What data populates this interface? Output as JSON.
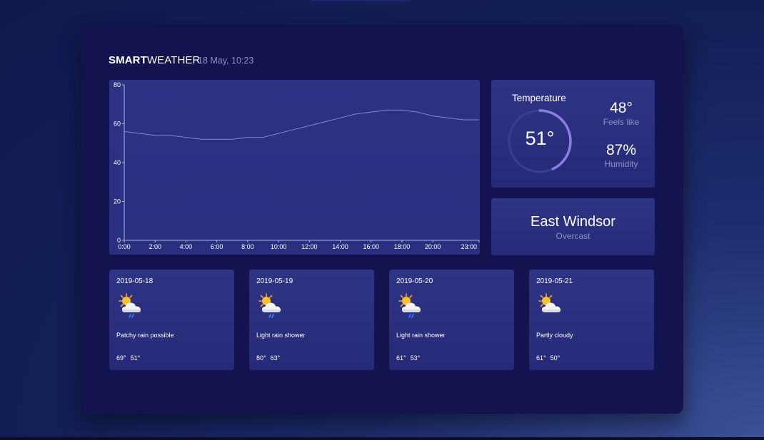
{
  "header": {
    "brand_bold": "SMART",
    "brand_light": "WEATHER",
    "datetime": "18 May, 10:23"
  },
  "chart_data": {
    "type": "line",
    "x": [
      0,
      1,
      2,
      3,
      4,
      5,
      6,
      7,
      8,
      9,
      10,
      11,
      12,
      13,
      14,
      15,
      16,
      17,
      18,
      19,
      20,
      21,
      22,
      23
    ],
    "xticks": [
      "0:00",
      "2:00",
      "4:00",
      "6:00",
      "8:00",
      "10:00",
      "12:00",
      "14:00",
      "16:00",
      "18:00",
      "20:00",
      "23:00"
    ],
    "xtick_hours": [
      0,
      2,
      4,
      6,
      8,
      10,
      12,
      14,
      16,
      18,
      20,
      23
    ],
    "yticks": [
      "0",
      "20",
      "40",
      "60",
      "80"
    ],
    "series": [
      {
        "values": [
          56,
          55,
          54,
          54,
          53,
          52,
          52,
          52,
          53,
          53,
          55,
          57,
          59,
          61,
          63,
          65,
          66,
          67,
          67,
          66,
          64,
          63,
          62,
          62
        ]
      }
    ],
    "xlim": [
      0,
      23
    ],
    "ylim": [
      0,
      80
    ],
    "grid": false,
    "line_color": "#8088d0"
  },
  "current": {
    "title": "Temperature",
    "temp": "51°",
    "gauge_fraction": 0.43,
    "feels_like": "48°",
    "feels_like_label": "Feels like",
    "humidity": "87%",
    "humidity_label": "Humidity"
  },
  "location": {
    "name": "East Windsor",
    "condition": "Overcast"
  },
  "forecast": [
    {
      "date": "2019-05-18",
      "icon": "sun-cloud-rain-icon",
      "desc": "Patchy rain possible",
      "high": "69°",
      "low": "51°"
    },
    {
      "date": "2019-05-19",
      "icon": "sun-cloud-rain-icon",
      "desc": "Light rain shower",
      "high": "80°",
      "low": "63°"
    },
    {
      "date": "2019-05-20",
      "icon": "sun-cloud-rain-icon",
      "desc": "Light rain shower",
      "high": "61°",
      "low": "53°"
    },
    {
      "date": "2019-05-21",
      "icon": "sun-cloud-icon",
      "desc": "Partly cloudy",
      "high": "61°",
      "low": "50°"
    }
  ],
  "colors": {
    "accent": "#8a7fe0",
    "muted": "#8d91c4",
    "panel": "#12134f",
    "card": "#2b3080"
  }
}
